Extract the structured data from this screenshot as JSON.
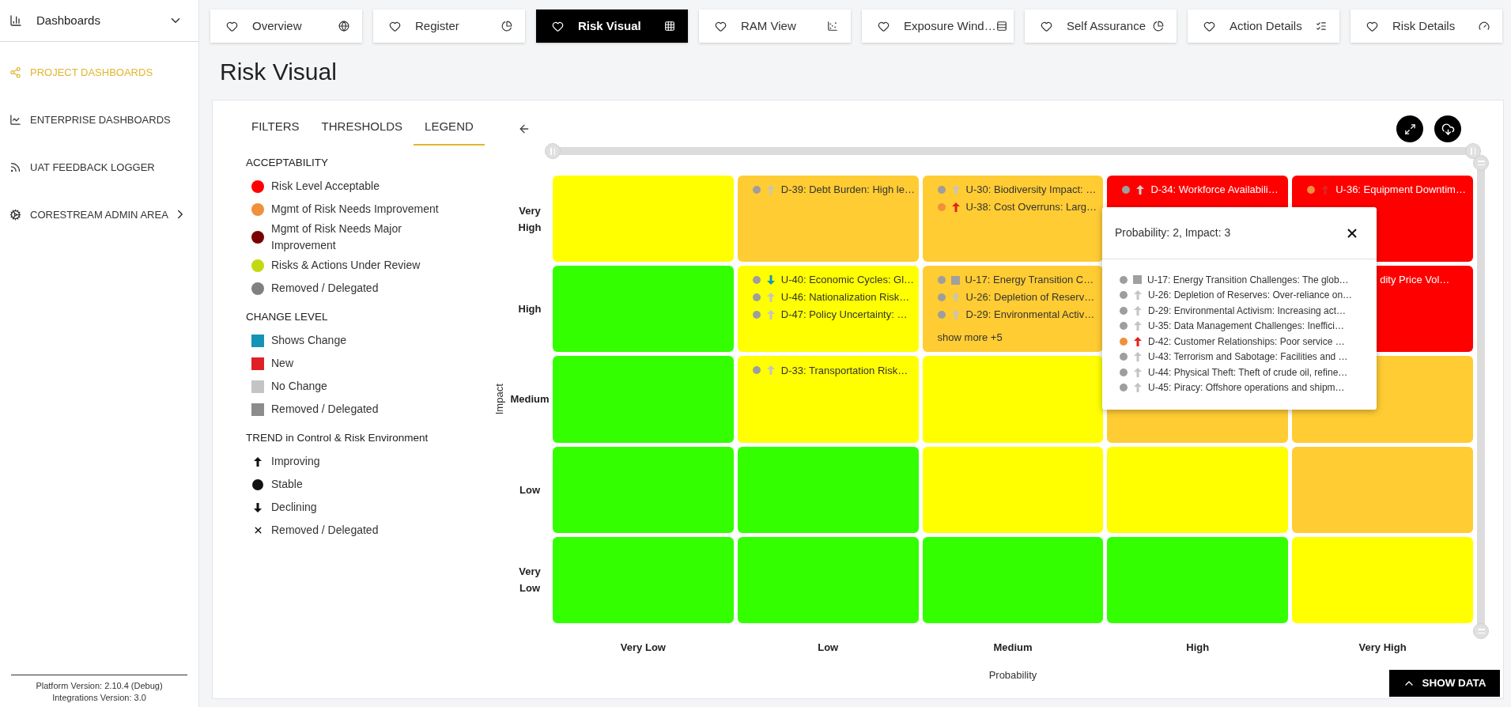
{
  "sidebar": {
    "header": {
      "label": "Dashboards"
    },
    "items": [
      {
        "label": "PROJECT DASHBOARDS",
        "selected": true,
        "has_children": false
      },
      {
        "label": "ENTERPRISE DASHBOARDS",
        "selected": false,
        "has_children": false
      },
      {
        "label": "UAT FEEDBACK LOGGER",
        "selected": false,
        "has_children": false
      },
      {
        "label": "CORESTREAM ADMIN AREA",
        "selected": false,
        "has_children": true
      }
    ],
    "footer": [
      "Platform Version: 2.10.4 (Debug)",
      "Integrations Version: 3.0"
    ]
  },
  "tabs": [
    {
      "label": "Overview",
      "selected": false
    },
    {
      "label": "Register",
      "selected": false
    },
    {
      "label": "Risk Visual",
      "selected": true
    },
    {
      "label": "RAM View",
      "selected": false
    },
    {
      "label": "Exposure Wind…",
      "selected": false
    },
    {
      "label": "Self Assurance",
      "selected": false
    },
    {
      "label": "Action Details",
      "selected": false
    },
    {
      "label": "Risk Details",
      "selected": false
    }
  ],
  "page_title": "Risk Visual",
  "panel_tabs": [
    {
      "label": "FILTERS",
      "selected": false
    },
    {
      "label": "THRESHOLDS",
      "selected": false
    },
    {
      "label": "LEGEND",
      "selected": true
    }
  ],
  "legend": {
    "sections": [
      {
        "title": "ACCEPTABILITY",
        "kind": "dot",
        "items": [
          {
            "label": "Risk Level Acceptable",
            "color": "#ff0000"
          },
          {
            "label": "Mgmt of Risk Needs Improvement",
            "color": "#f0903a"
          },
          {
            "label": "Mgmt of Risk Needs Major Improvement",
            "color": "#7a0000"
          },
          {
            "label": "Risks & Actions Under Review",
            "color": "#c3d90f"
          },
          {
            "label": "Removed / Delegated",
            "color": "#808080"
          }
        ]
      },
      {
        "title": "CHANGE LEVEL",
        "kind": "square",
        "items": [
          {
            "label": "Shows Change",
            "color": "#1593b5"
          },
          {
            "label": "New",
            "color": "#e02027"
          },
          {
            "label": "No Change",
            "color": "#c4c4c4"
          },
          {
            "label": "Removed / Delegated",
            "color": "#8c8c8c"
          }
        ]
      },
      {
        "title": "TREND in Control & Risk Environment",
        "kind": "trend",
        "items": [
          {
            "label": "Improving",
            "kind": "up"
          },
          {
            "label": "Stable",
            "kind": "circle"
          },
          {
            "label": "Declining",
            "kind": "down"
          },
          {
            "label": "Removed / Delegated",
            "kind": "cross"
          }
        ]
      }
    ]
  },
  "matrix": {
    "y_axis_title": "Impact",
    "x_axis_title": "Probability",
    "horizontal_slider": {
      "level": 1
    },
    "vertical_slider": {
      "level": 1
    },
    "impact_levels": [
      "Very High",
      "High",
      "Medium",
      "Low",
      "Very Low"
    ],
    "probability_levels": [
      "Very Low",
      "Low",
      "Medium",
      "High",
      "Very High"
    ],
    "cells": [
      [
        {
          "color": "#ffff00"
        },
        {
          "color": "#ffcc33",
          "items": [
            {
              "kind": "up",
              "text": "D-39: Debt Burden: High le…",
              "dot": {
                "color": "#9e9e9e"
              },
              "arrow": {
                "color": "#c4c4c4"
              }
            }
          ]
        },
        {
          "color": "#ffcc33",
          "items": [
            {
              "kind": "up",
              "text": "U-30: Biodiversity Impact: …",
              "dot": {
                "color": "#9e9e9e"
              },
              "arrow": {
                "color": "#c4c4c4"
              }
            },
            {
              "kind": "up",
              "text": "U-38: Cost Overruns: Larg…",
              "dot": {
                "color": "#f0903a"
              },
              "arrow": {
                "color": "#e3211d"
              }
            }
          ]
        },
        {
          "color": "#ff0000",
          "items": [
            {
              "kind": "up",
              "text": "D-34: Workforce Availabili…",
              "dot": {
                "color": "#9e9e9e"
              },
              "arrow": {
                "color": "#d0d0d0"
              }
            }
          ]
        },
        {
          "color": "#ff0000",
          "items": [
            {
              "kind": "up",
              "text": "U-36: Equipment Downtim…",
              "dot": {
                "color": "#f0903a"
              },
              "arrow": {
                "color": "#e3211d"
              }
            }
          ]
        }
      ],
      [
        {
          "color": "#33ff00"
        },
        {
          "color": "#ffff00",
          "items": [
            {
              "kind": "down",
              "text": "U-40: Economic Cycles: Gl…",
              "dot": {
                "color": "#9e9e9e"
              },
              "arrow": {
                "color": "#1a97b4"
              }
            },
            {
              "kind": "up",
              "text": "U-46: Nationalization Risk…",
              "dot": {
                "color": "#9e9e9e"
              },
              "arrow": {
                "color": "#c4c4c4"
              }
            },
            {
              "kind": "up",
              "text": "D-47: Policy Uncertainty: …",
              "dot": {
                "color": "#9e9e9e"
              },
              "arrow": {
                "color": "#c4c4c4"
              }
            }
          ]
        },
        {
          "color": "#ffcc33",
          "items": [
            {
              "kind": "square",
              "text": "U-17: Energy Transition C…",
              "dot": {
                "color": "#9e9e9e"
              },
              "arrow": {
                "color": "#a0a0a0"
              }
            },
            {
              "kind": "up",
              "text": "U-26: Depletion of Reserv…",
              "dot": {
                "color": "#9e9e9e"
              },
              "arrow": {
                "color": "#c4c4c4"
              }
            },
            {
              "kind": "up",
              "text": "D-29: Environmental Activ…",
              "dot": {
                "color": "#9e9e9e"
              },
              "arrow": {
                "color": "#c4c4c4"
              }
            }
          ],
          "more": "show more +5"
        },
        {},
        {
          "color": "#ff0000",
          "items": [
            {
              "kind": "clipped",
              "text": "dity Price Vol…"
            }
          ]
        }
      ],
      [
        {
          "color": "#33ff00"
        },
        {
          "color": "#ffff00",
          "items": [
            {
              "kind": "up",
              "text": "D-33: Transportation Risk…",
              "dot": {
                "color": "#9e9e9e"
              },
              "arrow": {
                "color": "#c4c4c4"
              }
            }
          ]
        },
        {
          "color": "#ffff00"
        },
        {
          "color": "#ffcc33"
        },
        {
          "color": "#ffcc33"
        }
      ],
      [
        {
          "color": "#33ff00"
        },
        {
          "color": "#33ff00"
        },
        {
          "color": "#ffff00"
        },
        {
          "color": "#ffff00"
        },
        {
          "color": "#ffcc33"
        }
      ],
      [
        {
          "color": "#33ff00"
        },
        {
          "color": "#33ff00"
        },
        {
          "color": "#33ff00"
        },
        {
          "color": "#33ff00"
        },
        {
          "color": "#ffff00"
        }
      ]
    ]
  },
  "popup": {
    "title": "Probability: 2, Impact: 3",
    "items": [
      {
        "kind": "square",
        "text": "U-17: Energy Transition Challenges: The glob…",
        "dot": {
          "color": "#9e9e9e"
        },
        "arrow": {
          "color": "#a0a0a0"
        }
      },
      {
        "kind": "up",
        "text": "U-26: Depletion of Reserves: Over-reliance on…",
        "dot": {
          "color": "#9e9e9e"
        },
        "arrow": {
          "color": "#c4c4c4"
        }
      },
      {
        "kind": "up",
        "text": "D-29: Environmental Activism: Increasing act…",
        "dot": {
          "color": "#9e9e9e"
        },
        "arrow": {
          "color": "#c4c4c4"
        }
      },
      {
        "kind": "up",
        "text": "U-35: Data Management Challenges: Ineffici…",
        "dot": {
          "color": "#9e9e9e"
        },
        "arrow": {
          "color": "#c4c4c4"
        }
      },
      {
        "kind": "up",
        "text": "D-42: Customer Relationships: Poor service …",
        "dot": {
          "color": "#f0903a"
        },
        "arrow": {
          "color": "#e3211d"
        }
      },
      {
        "kind": "up",
        "text": "U-43: Terrorism and Sabotage: Facilities and …",
        "dot": {
          "color": "#9e9e9e"
        },
        "arrow": {
          "color": "#c4c4c4"
        }
      },
      {
        "kind": "up",
        "text": "U-44: Physical Theft: Theft of crude oil, refine…",
        "dot": {
          "color": "#9e9e9e"
        },
        "arrow": {
          "color": "#c4c4c4"
        }
      },
      {
        "kind": "up",
        "text": "U-45: Piracy: Offshore operations and shipm…",
        "dot": {
          "color": "#9e9e9e"
        },
        "arrow": {
          "color": "#c4c4c4"
        }
      }
    ]
  },
  "show_data_button": "SHOW DATA"
}
